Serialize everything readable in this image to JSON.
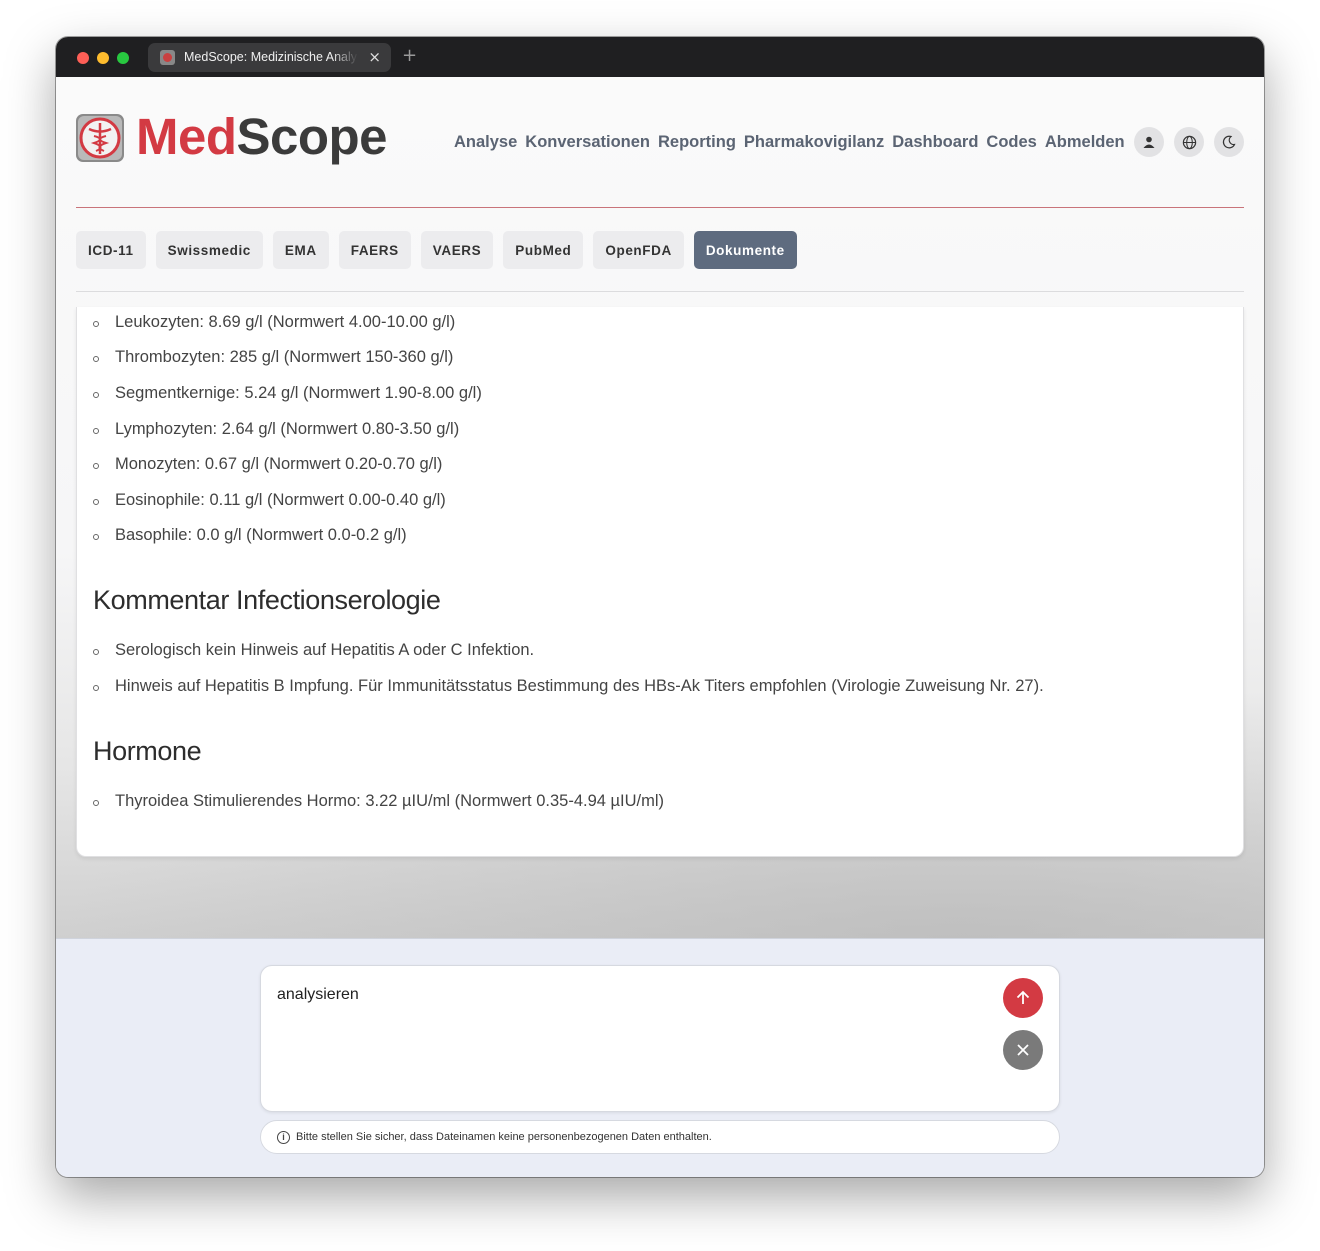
{
  "browser": {
    "tab_title": "MedScope: Medizinische Analyse",
    "close_glyph": "×",
    "new_tab_glyph": "+"
  },
  "header": {
    "brand_part1": "Med",
    "brand_part2": "Scope",
    "nav": [
      "Analyse",
      "Konversationen",
      "Reporting",
      "Pharmakovigilanz",
      "Dashboard",
      "Codes",
      "Abmelden"
    ],
    "icons": [
      "user-icon",
      "globe-icon",
      "moon-icon"
    ]
  },
  "sources": {
    "items": [
      "ICD-11",
      "Swissmedic",
      "EMA",
      "FAERS",
      "VAERS",
      "PubMed",
      "OpenFDA",
      "Dokumente"
    ],
    "active": "Dokumente"
  },
  "document": {
    "blood_list": [
      "Leukozyten: 8.69 g/l (Normwert 4.00-10.00 g/l)",
      "Thrombozyten: 285 g/l (Normwert 150-360 g/l)",
      "Segmentkernige: 5.24 g/l (Normwert 1.90-8.00 g/l)",
      "Lymphozyten: 2.64 g/l (Normwert 0.80-3.50 g/l)",
      "Monozyten: 0.67 g/l (Normwert 0.20-0.70 g/l)",
      "Eosinophile: 0.11 g/l (Normwert 0.00-0.40 g/l)",
      "Basophile: 0.0 g/l (Normwert 0.0-0.2 g/l)"
    ],
    "section1_title": "Kommentar Infectionserologie",
    "section1_list": [
      "Serologisch kein Hinweis auf Hepatitis A oder C Infektion.",
      "Hinweis auf Hepatitis B Impfung. Für Immunitätsstatus Bestimmung des HBs-Ak Titers empfohlen (Virologie Zuweisung Nr. 27)."
    ],
    "section2_title": "Hormone",
    "section2_list": [
      "Thyroidea Stimulierendes Hormo: 3.22 µIU/ml (Normwert 0.35-4.94 µIU/ml)"
    ]
  },
  "composer": {
    "value": "analysieren",
    "send_icon": "arrow-up-icon",
    "cancel_icon": "close-icon"
  },
  "notice": {
    "icon": "info-icon",
    "text": "Bitte stellen Sie sicher, dass Dateinamen keine personenbezogenen Daten enthalten."
  },
  "colors": {
    "brand_red": "#d33a43",
    "active_tab": "#5e6b7f",
    "nav_text": "#5b6473"
  }
}
